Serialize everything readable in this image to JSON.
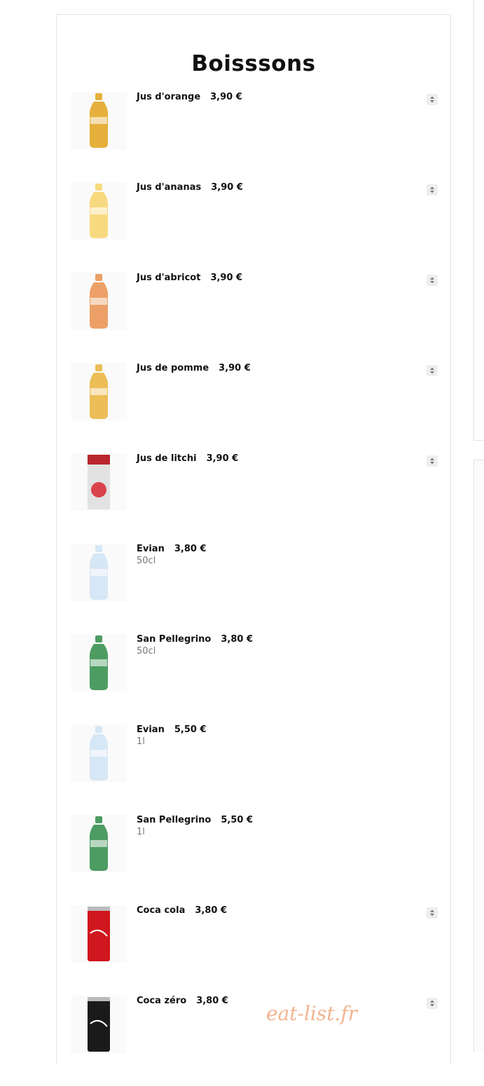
{
  "menu": {
    "title": "Boisssons",
    "items": [
      {
        "name": "Jus d'orange",
        "price": "3,90 €",
        "desc": "",
        "image": "orange-juice-bottle-icon",
        "color": "#e0a21a",
        "stepper": true
      },
      {
        "name": "Jus d'ananas",
        "price": "3,90 €",
        "desc": "",
        "image": "pineapple-juice-bottle-icon",
        "color": "#f6d36a",
        "stepper": true
      },
      {
        "name": "Jus d'abricot",
        "price": "3,90 €",
        "desc": "",
        "image": "apricot-juice-bottle-icon",
        "color": "#e98f4e",
        "stepper": true
      },
      {
        "name": "Jus de pomme",
        "price": "3,90 €",
        "desc": "",
        "image": "apple-juice-bottle-icon",
        "color": "#e9b33a",
        "stepper": true
      },
      {
        "name": "Jus de litchi",
        "price": "3,90 €",
        "desc": "",
        "image": "litchi-juice-carton-icon",
        "color": "#e2e2e2",
        "stepper": true
      },
      {
        "name": "Evian",
        "price": "3,80 €",
        "desc": "50cl",
        "image": "evian-bottle-icon",
        "color": "#cfe3f3",
        "stepper": false
      },
      {
        "name": "San Pellegrino",
        "price": "3,80 €",
        "desc": "50cl",
        "image": "san-pellegrino-bottle-icon",
        "color": "#2e8b45",
        "stepper": false
      },
      {
        "name": "Evian",
        "price": "5,50 €",
        "desc": "1l",
        "image": "evian-bottle-icon",
        "color": "#cfe3f3",
        "stepper": false
      },
      {
        "name": "San Pellegrino",
        "price": "5,50 €",
        "desc": "1l",
        "image": "san-pellegrino-bottle-icon",
        "color": "#2e8b45",
        "stepper": false
      },
      {
        "name": "Coca cola",
        "price": "3,80 €",
        "desc": "",
        "image": "coca-cola-can-icon",
        "color": "#d0161e",
        "stepper": true
      },
      {
        "name": "Coca zéro",
        "price": "3,80 €",
        "desc": "",
        "image": "coca-zero-can-icon",
        "color": "#1a1a1a",
        "stepper": true
      }
    ]
  },
  "watermark": "eat-list.fr"
}
